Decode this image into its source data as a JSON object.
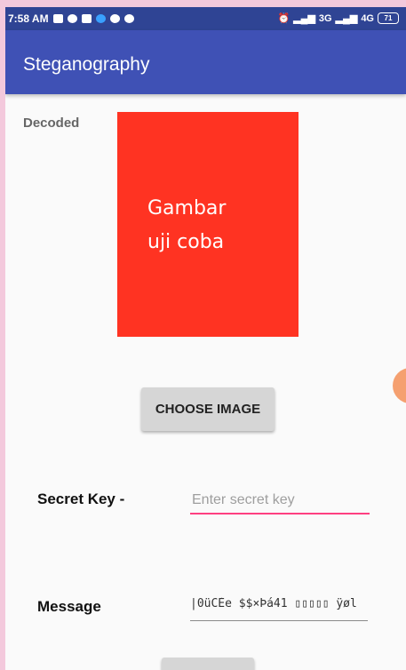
{
  "status_bar": {
    "time": "7:58 AM",
    "signal_text": "3G",
    "signal_text_2": "4G",
    "battery": "71",
    "left_icons": [
      "video-icon",
      "whatsapp-icon",
      "message-icon",
      "chrome-icon",
      "chat-icon",
      "app-icon"
    ],
    "right_icons": [
      "alarm-icon",
      "signal-icon",
      "signal-icon",
      "battery-icon"
    ]
  },
  "app_bar": {
    "title": "Steganography",
    "color": "#3f51b5"
  },
  "decoded": {
    "label": "Decoded"
  },
  "image": {
    "background": "#ff3322",
    "text": "Gambar\nuji coba"
  },
  "choose_button": {
    "label": "CHOOSE IMAGE"
  },
  "secret_key": {
    "label": "Secret Key -",
    "placeholder": "Enter secret key",
    "value": ""
  },
  "message": {
    "label": "Message",
    "value": "|0üCÈe $$×Þá41  ▯▯▯▯▯ ÿøl"
  }
}
